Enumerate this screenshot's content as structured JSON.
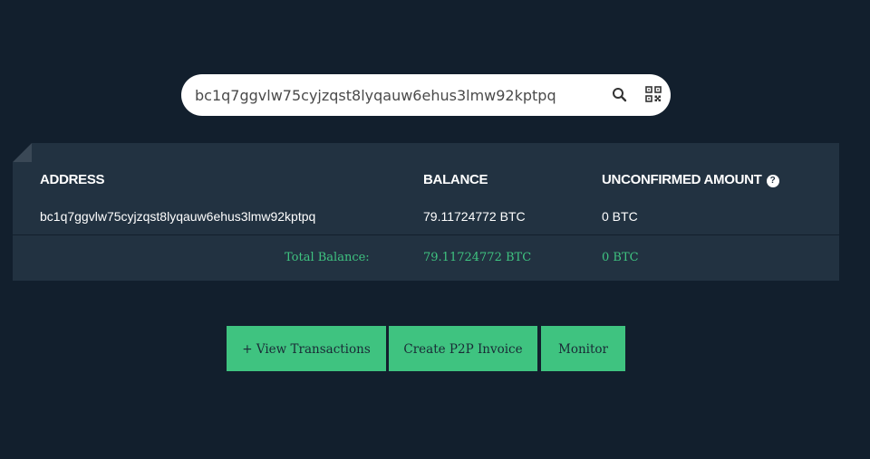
{
  "search": {
    "value": "bc1q7ggvlw75cyjzqst8lyqauw6ehus3lmw92kptpq",
    "search_icon": "search-icon",
    "qr_icon": "qr-code-icon"
  },
  "table": {
    "headers": {
      "address": "ADDRESS",
      "balance": "BALANCE",
      "unconfirmed": "UNCONFIRMED AMOUNT",
      "help_glyph": "?"
    },
    "rows": [
      {
        "address": "bc1q7ggvlw75cyjzqst8lyqauw6ehus3lmw92kptpq",
        "balance": "79.11724772 BTC",
        "unconfirmed": "0 BTC"
      }
    ],
    "total": {
      "label": "Total Balance:",
      "balance": "79.11724772 BTC",
      "unconfirmed": "0 BTC"
    }
  },
  "actions": {
    "view_transactions": "+ View Transactions",
    "create_invoice": "Create P2P Invoice",
    "monitor": "Monitor"
  },
  "colors": {
    "background": "#121f2d",
    "panel": "#223241",
    "accent": "#3fc380",
    "text": "#ffffff"
  }
}
